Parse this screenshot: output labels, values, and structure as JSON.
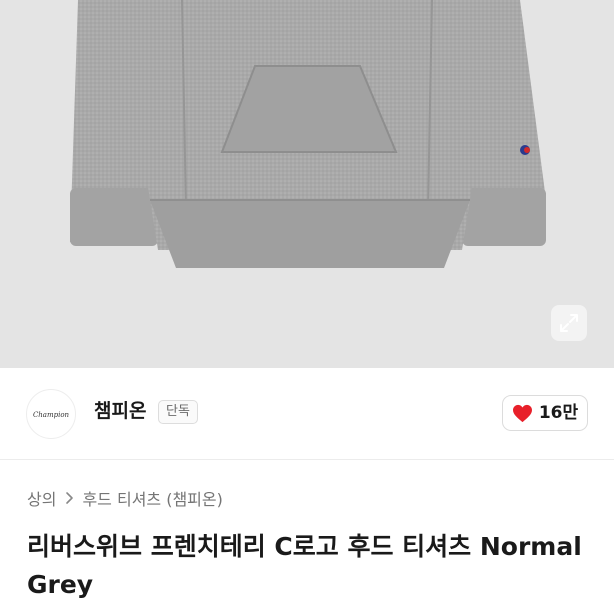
{
  "hero": {
    "product_image": "gray-hoodie-photo",
    "expand_icon": "expand-arrows-icon"
  },
  "seller": {
    "logo_text": "Champion",
    "name": "챔피온",
    "badge": "단독"
  },
  "like": {
    "icon": "heart-icon",
    "count": "16만",
    "color": "#e8202a"
  },
  "breadcrumb": {
    "items": [
      "상의",
      "후드 티셔츠 (챔피온)"
    ],
    "separator_icon": "chevron-right-icon"
  },
  "product": {
    "title": "리버스위브 프렌치테리 C로고 후드 티셔츠 Normal Grey"
  }
}
